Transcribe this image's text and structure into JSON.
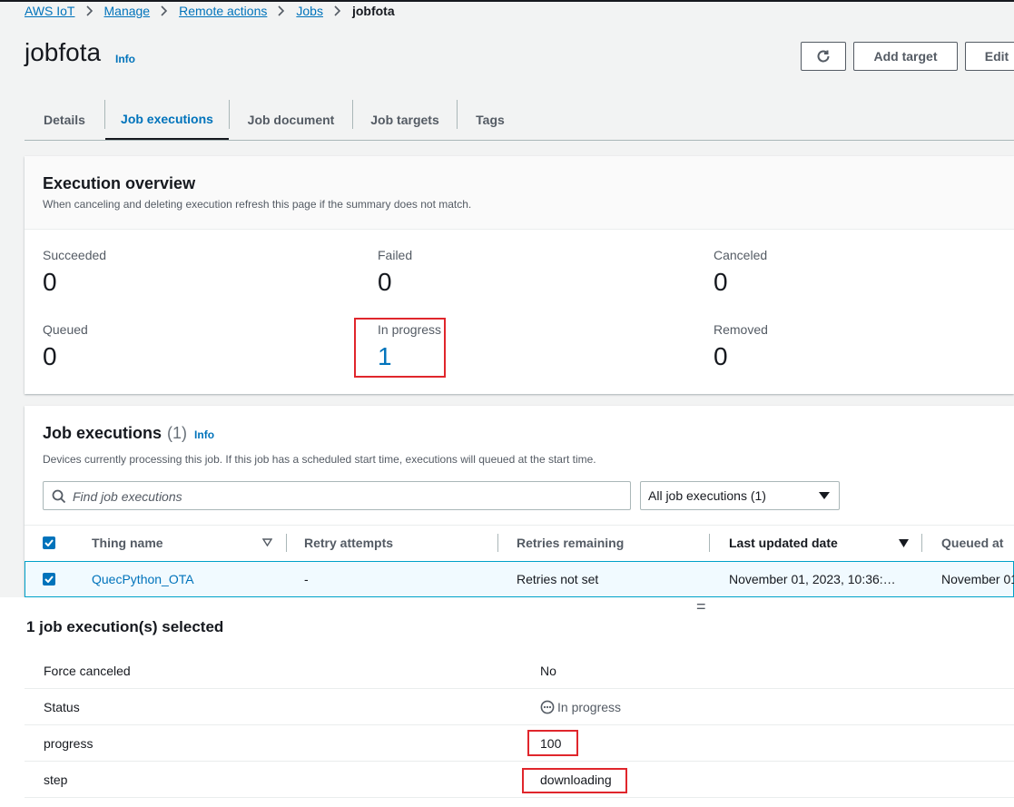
{
  "breadcrumb": {
    "items": [
      "AWS IoT",
      "Manage",
      "Remote actions",
      "Jobs"
    ],
    "current": "jobfota"
  },
  "header": {
    "title": "jobfota",
    "info_label": "Info",
    "refresh_icon": "refresh-icon",
    "add_target_label": "Add target",
    "edit_label": "Edit"
  },
  "tabs": [
    {
      "label": "Details"
    },
    {
      "label": "Job executions",
      "active": true
    },
    {
      "label": "Job document"
    },
    {
      "label": "Job targets"
    },
    {
      "label": "Tags"
    }
  ],
  "overview": {
    "title": "Execution overview",
    "description": "When canceling and deleting execution refresh this page if the summary does not match.",
    "stats": [
      {
        "label": "Succeeded",
        "value": "0"
      },
      {
        "label": "Failed",
        "value": "0"
      },
      {
        "label": "Canceled",
        "value": "0"
      },
      {
        "label": "Queued",
        "value": "0"
      },
      {
        "label": "In progress",
        "value": "1"
      },
      {
        "label": "Removed",
        "value": "0"
      }
    ]
  },
  "executions": {
    "title": "Job executions",
    "count": "(1)",
    "info_label": "Info",
    "description": "Devices currently processing this job. If this job has a scheduled start time, executions will queued at the start time.",
    "search_placeholder": "Find job executions",
    "filter_selected": "All job executions (1)",
    "columns": [
      "Thing name",
      "Retry attempts",
      "Retries remaining",
      "Last updated date",
      "Queued at"
    ],
    "rows": [
      {
        "thing_name": "QuecPython_OTA",
        "retry_attempts": "-",
        "retries_remaining": "Retries not set",
        "last_updated": "November 01, 2023, 10:36:…",
        "queued_at": "November 01"
      }
    ]
  },
  "split_panel": {
    "handle": "=",
    "title": "1 job execution(s) selected",
    "fields": [
      {
        "key": "Force canceled",
        "value": "No"
      },
      {
        "key": "Status",
        "value": "In progress"
      },
      {
        "key": "progress",
        "value": "100"
      },
      {
        "key": "step",
        "value": "downloading"
      }
    ]
  },
  "colors": {
    "link": "#0073bb",
    "highlight_box": "#e0262c",
    "selected_row_bg": "#f1faff"
  }
}
